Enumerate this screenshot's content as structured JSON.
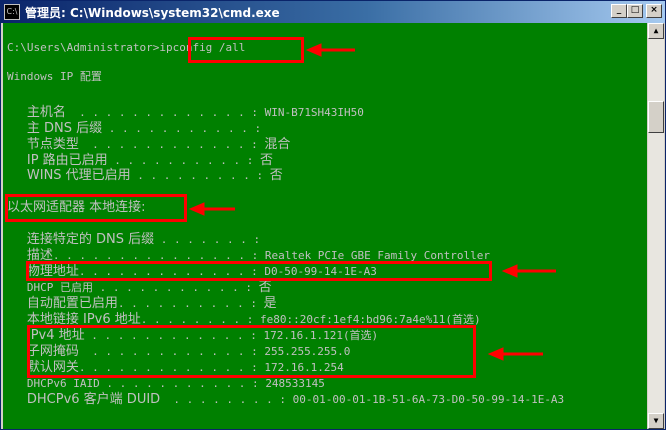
{
  "window": {
    "title": "管理员: C:\\Windows\\system32\\cmd.exe",
    "icon_label": "C:\\",
    "controls": {
      "minimize": "_",
      "maximize": "□",
      "close": "×"
    }
  },
  "console": {
    "prompt": "C:\\Users\\Administrator>",
    "command": "ipconfig /all",
    "section_header": "Windows IP 配置",
    "host_name": {
      "label": "主机名",
      "dots": "  . . . . . . . . . . . . . :",
      "value": "WIN-B71SH43IH50"
    },
    "dns_suffix": {
      "label": "主 DNS 后缀",
      "dots": " . . . . . . . . . . . :",
      "value": ""
    },
    "node_type": {
      "label": "节点类型",
      "dots": "  . . . . . . . . . . . . :",
      "value": "混合"
    },
    "ip_routing": {
      "label": "IP 路由已启用",
      "dots": " . . . . . . . . . . :",
      "value": "否"
    },
    "wins_proxy": {
      "label": "WINS 代理已启用",
      "dots": " . . . . . . . . . :",
      "value": "否"
    },
    "adapter_header": "以太网适配器 本地连接:",
    "conn_dns_suffix": {
      "label": "连接特定的 DNS 后缀",
      "dots": " . . . . . . . :",
      "value": ""
    },
    "description": {
      "label": "描述",
      "dots": ". . . . . . . . . . . . . . . :",
      "value": "Realtek PCIe GBE Family Controller"
    },
    "physical_addr": {
      "label": "物理地址",
      "dots": ". . . . . . . . . . . . . :",
      "value": "D0-50-99-14-1E-A3"
    },
    "dhcp_enabled": {
      "label": "DHCP 已启用",
      "dots": " . . . . . . . . . . . :",
      "value": "否"
    },
    "autoconfig": {
      "label": "自动配置已启用",
      "dots": ". . . . . . . . . . :",
      "value": "是"
    },
    "link_local": {
      "label": "本地链接 IPv6 地址",
      "dots": ". . . . . . . . :",
      "value": "fe80::20cf:1ef4:bd96:7a4e%11(首选)"
    },
    "ipv4": {
      "label": "IPv4 地址",
      "dots": " . . . . . . . . . . . . :",
      "value": "172.16.1.121(首选)"
    },
    "subnet": {
      "label": "子网掩码",
      "dots": "  . . . . . . . . . . . . :",
      "value": "255.255.255.0"
    },
    "gateway": {
      "label": "默认网关",
      "dots": ". . . . . . . . . . . . . :",
      "value": "172.16.1.254"
    },
    "dhcpv6_iaid": {
      "label": "DHCPv6 IAID",
      "dots": " . . . . . . . . . . . :",
      "value": "248533145"
    },
    "dhcpv6_duid": {
      "label": "DHCPv6 客户端 DUID",
      "dots": "  . . . . . . . . :",
      "value": "00-01-00-01-1B-51-6A-73-D0-50-99-14-1E-A3"
    }
  },
  "annotation_color": "#ff0000",
  "console_colors": {
    "background": "#008000",
    "text": "#c0c0c0"
  }
}
